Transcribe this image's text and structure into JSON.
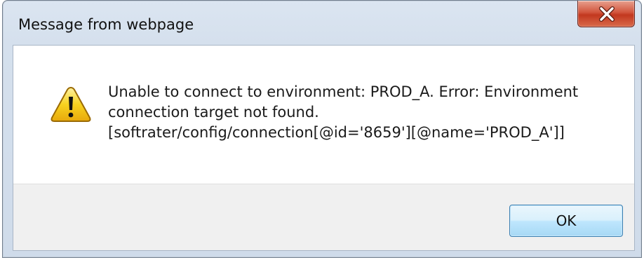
{
  "window": {
    "title": "Message from webpage",
    "close_icon": "close-icon"
  },
  "message": {
    "icon": "warning-icon",
    "lines": [
      "Unable to connect to environment: PROD_A.  Error: Environment",
      "connection target not found.",
      "[softrater/config/connection[@id='8659'][@name='PROD_A']]"
    ]
  },
  "buttons": {
    "ok_label": "OK"
  },
  "colors": {
    "close_button": "#c9452b",
    "ok_button_border": "#3c7fb1",
    "warning_fill": "#f7d21f"
  }
}
